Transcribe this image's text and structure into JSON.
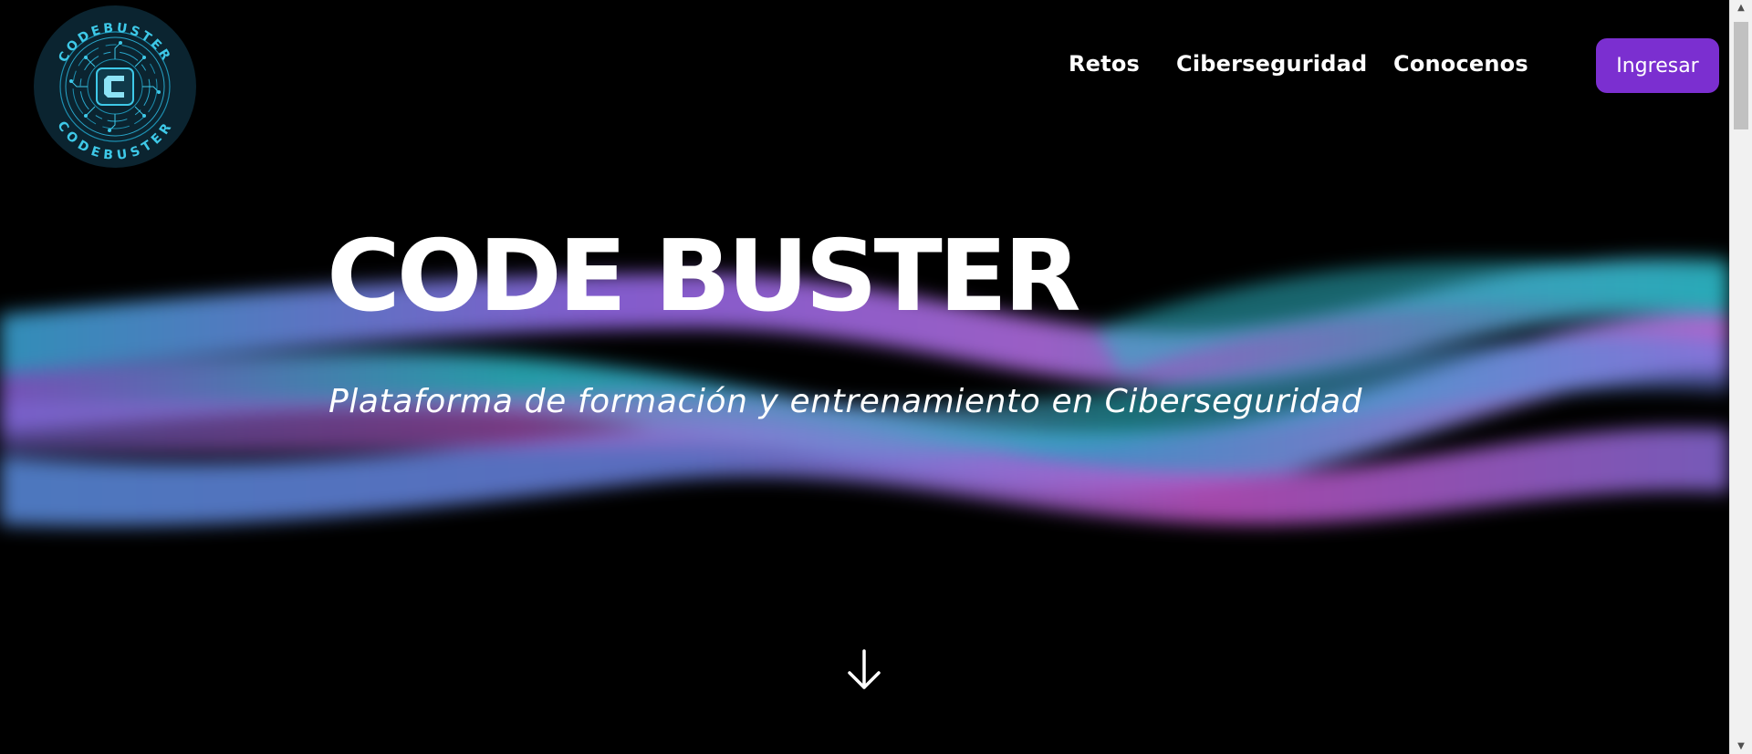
{
  "logo": {
    "top_text": "CODEBUSTER",
    "bottom_text": "CODEBUSTER",
    "icon": "code-c-icon",
    "color": "#3ec9e8"
  },
  "nav": {
    "items": [
      {
        "label": "Retos"
      },
      {
        "label": "Ciberseguridad"
      },
      {
        "label": "Conocenos"
      }
    ],
    "login_label": "Ingresar",
    "login_color": "#7b2fd0"
  },
  "hero": {
    "title": "CODE BUSTER",
    "subtitle": "Plataforma de formación y entrenamiento en Ciberseguridad",
    "scroll_icon": "arrow-down-icon"
  },
  "theme": {
    "background": "#000000",
    "wave_colors": [
      "#2bb7c4",
      "#9a6cf0",
      "#c45fd6",
      "#5a8de0"
    ]
  }
}
